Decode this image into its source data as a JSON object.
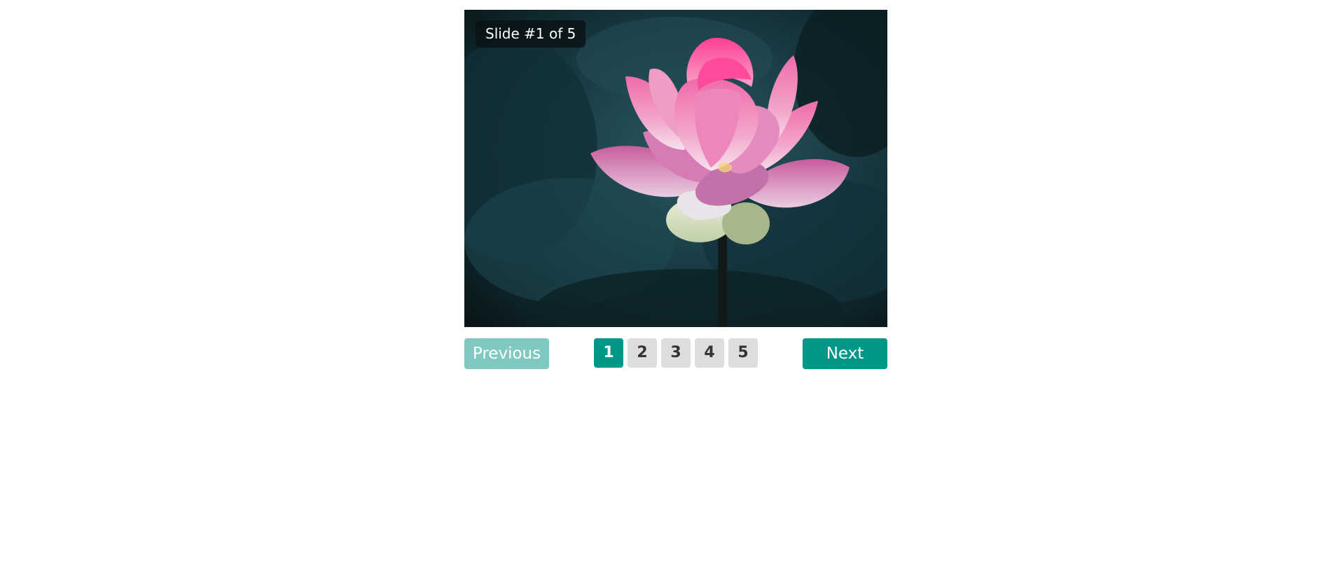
{
  "slider": {
    "counter_text": "Slide #1 of 5",
    "image_subject": "pink-lotus-flower",
    "prev_label": "Previous",
    "next_label": "Next",
    "pages": [
      "1",
      "2",
      "3",
      "4",
      "5"
    ],
    "active_page": "1",
    "colors": {
      "accent": "#009688",
      "accent_disabled": "#7fc9c0",
      "page_inactive": "#dddddd",
      "page_text": "#333333"
    }
  }
}
